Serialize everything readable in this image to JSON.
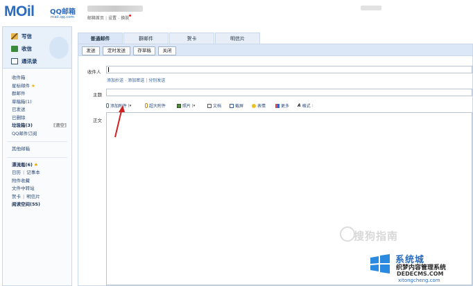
{
  "header": {
    "logo_text": "MOil",
    "logo_qq": "QQ邮箱",
    "logo_domain": "mail.qq.com",
    "user_links": [
      "邮箱首页",
      "设置",
      "换肤"
    ]
  },
  "quick_actions": [
    "写信",
    "收信",
    "通讯录"
  ],
  "folders": {
    "group1": [
      "收件箱",
      "星标邮件",
      "群邮件",
      "草稿箱(1)",
      "已发送",
      "已删除"
    ],
    "spam": {
      "label": "垃圾箱(3)",
      "action": "[清空]"
    },
    "subscription": "QQ邮件订阅",
    "other": "其他邮箱",
    "drift": "漂流瓶(6)",
    "calendar": "日历",
    "notes": "记事本",
    "attachments": "附件收藏",
    "transfer": "文件中转站",
    "card": "贺卡",
    "postcard": "明信片",
    "reading": "阅读空间(55)"
  },
  "tabs": [
    "普通邮件",
    "群邮件",
    "贺卡",
    "明信片"
  ],
  "toolbar": {
    "send": "发送",
    "scheduled": "定时发送",
    "save_draft": "存草稿",
    "close": "关闭"
  },
  "compose": {
    "recipient_label": "收件人",
    "add_cc": "添加抄送",
    "add_bcc": "添加密送",
    "separate": "分别发送",
    "subject_label": "主题",
    "body_label": "正文"
  },
  "editor_tools": {
    "attach": "添加附件",
    "big_attach": "超大附件",
    "photo": "照片",
    "doc": "文档",
    "screenshot": "截屏",
    "emoji": "表情",
    "more": "更多",
    "format": "格式"
  },
  "watermarks": {
    "sogou": "搜狗指南",
    "site_title": "系统城",
    "site_sub1": "织梦内容管理系统",
    "site_sub2": "DEDECMS.COM",
    "site_url": "xitongcheng.com"
  },
  "colors": {
    "accent": "#2a6bbf",
    "panel_bg": "#dbe7f6",
    "annotation": "#d02020"
  }
}
